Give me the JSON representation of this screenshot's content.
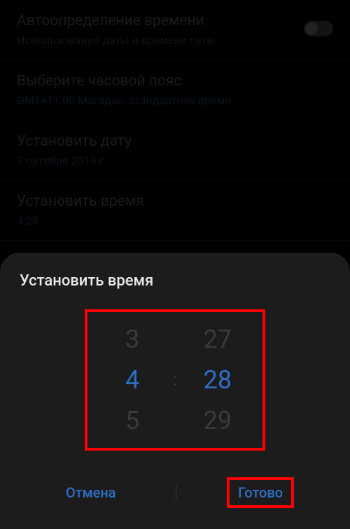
{
  "settings": {
    "auto_time": {
      "title": "Автоопределение времени",
      "subtitle": "Использование даты и времени сети."
    },
    "timezone": {
      "title": "Выберите часовой пояс",
      "subtitle": "GMT+11:00 Магадан, стандартное время"
    },
    "date": {
      "title": "Установить дату",
      "subtitle": "3 октября 2019 г."
    },
    "time": {
      "title": "Установить время",
      "subtitle": "4:28"
    }
  },
  "dialog": {
    "title": "Установить время",
    "picker": {
      "hour_prev": "3",
      "hour_sel": "4",
      "hour_next": "5",
      "colon": ":",
      "min_prev": "27",
      "min_sel": "28",
      "min_next": "29"
    },
    "cancel": "Отмена",
    "done": "Готово"
  }
}
